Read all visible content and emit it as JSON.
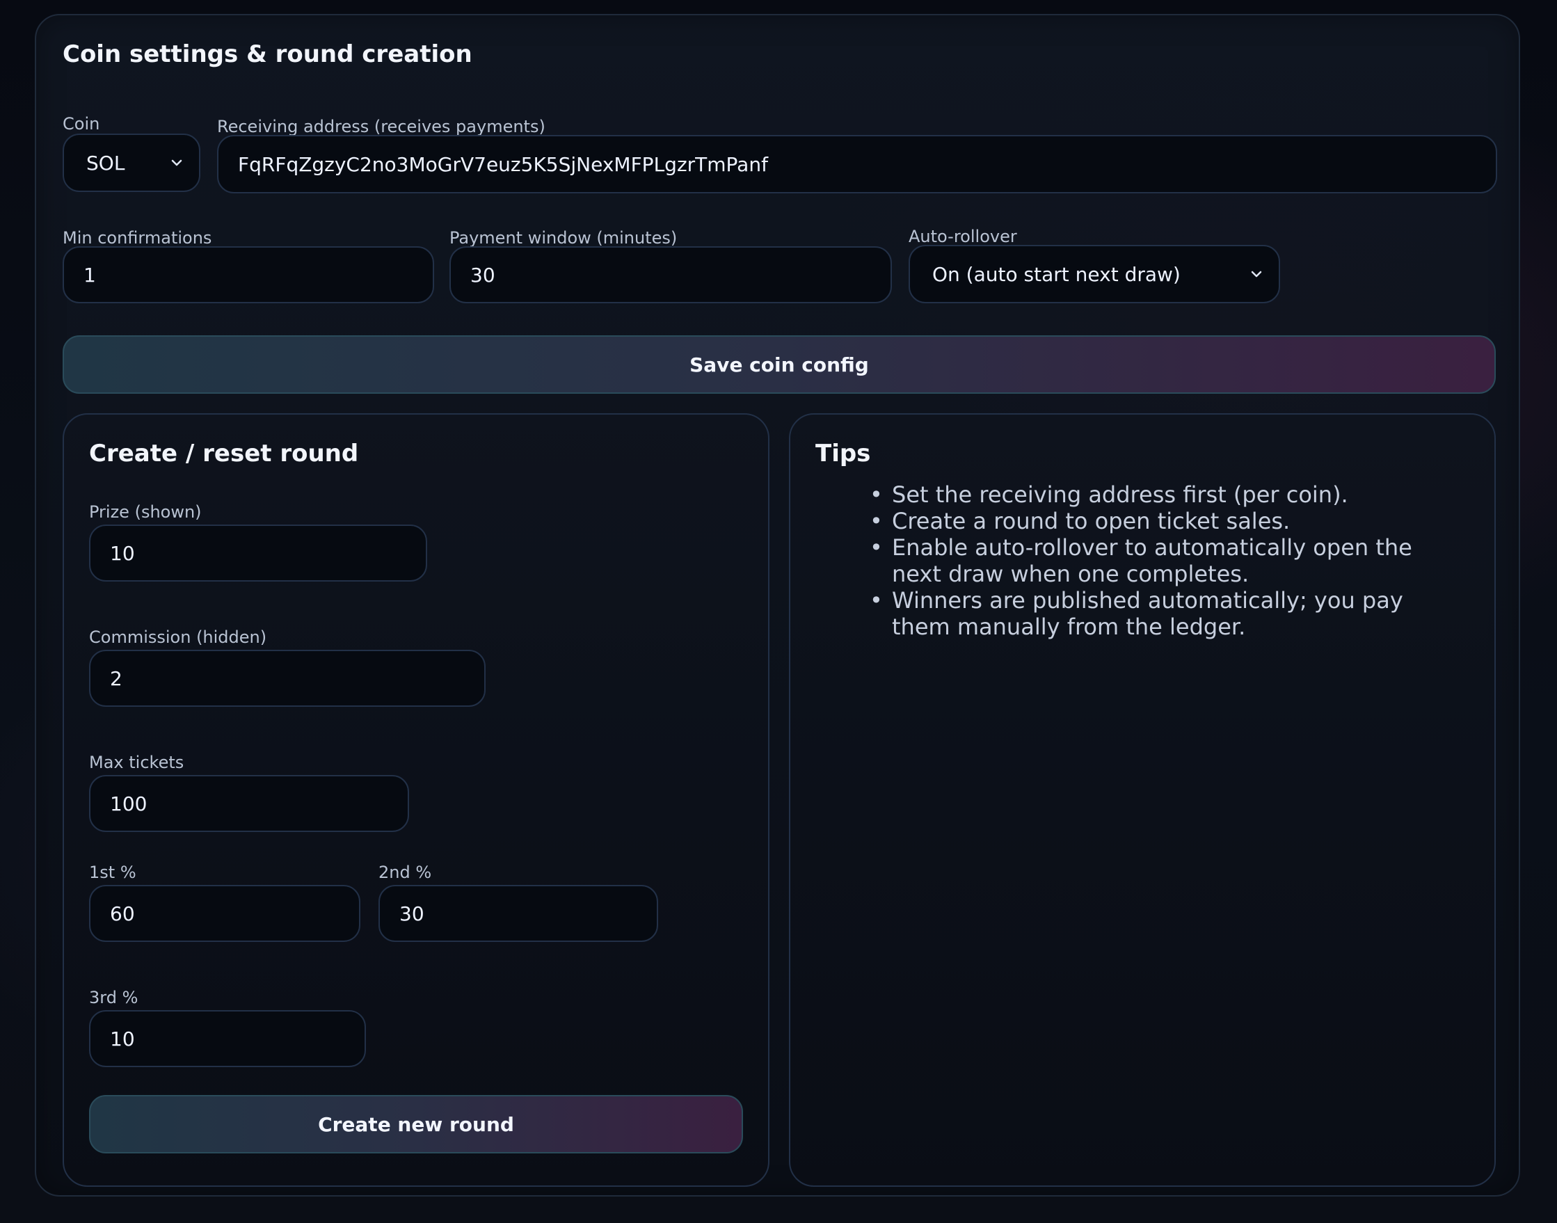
{
  "coin_settings": {
    "title": "Coin settings & round creation",
    "coin_label": "Coin",
    "coin_value": "SOL",
    "address_label": "Receiving address (receives payments)",
    "address_value": "FqRFqZgzyC2no3MoGrV7euz5K5SjNexMFPLgzrTmPanf",
    "min_conf_label": "Min confirmations",
    "min_conf_value": "1",
    "payment_window_label": "Payment window (minutes)",
    "payment_window_value": "30",
    "autorollover_label": "Auto-rollover",
    "autorollover_value": "On (auto start next draw)",
    "save_button_label": "Save coin config"
  },
  "create_round": {
    "title": "Create / reset round",
    "prize_label": "Prize (shown)",
    "prize_value": "10",
    "commission_label": "Commission (hidden)",
    "commission_value": "2",
    "max_tickets_label": "Max tickets",
    "max_tickets_value": "100",
    "first_pct_label": "1st %",
    "first_pct_value": "60",
    "second_pct_label": "2nd %",
    "second_pct_value": "30",
    "third_pct_label": "3rd %",
    "third_pct_value": "10",
    "create_button_label": "Create new round"
  },
  "tips": {
    "title": "Tips",
    "items": [
      "Set the receiving address first (per coin).",
      "Create a round to open ticket sales.",
      "Enable auto-rollover to automatically open the next draw when one completes.",
      "Winners are published automatically; you pay them manually from the ledger."
    ]
  },
  "icons": {
    "coin_select": "chevron-down-icon",
    "autorollover_select": "chevron-down-icon"
  },
  "colors": {
    "accent_start": "#203645",
    "accent_end": "#3a2040",
    "border": "#223047",
    "input_bg": "#060a11"
  }
}
